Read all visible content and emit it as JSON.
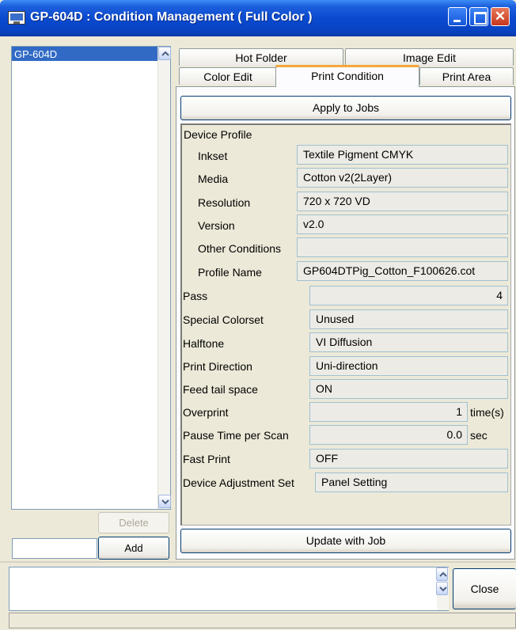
{
  "window": {
    "title": "GP-604D : Condition Management ( Full Color )",
    "title_color": "#0a4ad0"
  },
  "left_panel": {
    "items": [
      {
        "label": "GP-604D",
        "selected": true
      }
    ],
    "delete_label": "Delete",
    "name_input_value": "",
    "add_label": "Add"
  },
  "tabs": [
    {
      "label": "Hot Folder",
      "active": false
    },
    {
      "label": "Image Edit",
      "active": false
    },
    {
      "label": "Color Edit",
      "active": false
    },
    {
      "label": "Print Condition",
      "active": true
    },
    {
      "label": "Print Area",
      "active": false
    }
  ],
  "buttons": {
    "apply": "Apply to Jobs",
    "update": "Update with Job",
    "close": "Close"
  },
  "device_profile": {
    "heading": "Device Profile",
    "inkset": {
      "label": "Inkset",
      "value": "Textile Pigment CMYK"
    },
    "media": {
      "label": "Media",
      "value": "Cotton v2(2Layer)"
    },
    "resolution": {
      "label": "Resolution",
      "value": "720 x 720 VD"
    },
    "version": {
      "label": "Version",
      "value": "v2.0"
    },
    "other_conditions": {
      "label": "Other Conditions",
      "value": ""
    },
    "profile_name": {
      "label": "Profile Name",
      "value": "GP604DTPig_Cotton_F100626.cot"
    }
  },
  "settings": {
    "pass": {
      "label": "Pass",
      "value": "4"
    },
    "special_colorset": {
      "label": "Special Colorset",
      "value": "Unused"
    },
    "halftone": {
      "label": "Halftone",
      "value": "VI Diffusion"
    },
    "print_direction": {
      "label": "Print Direction",
      "value": "Uni-direction"
    },
    "feed_tail_space": {
      "label": "Feed tail space",
      "value": "ON"
    },
    "overprint": {
      "label": "Overprint",
      "value": "1",
      "unit": "time(s)"
    },
    "pause_time": {
      "label": "Pause Time per Scan",
      "value": "0.0",
      "unit": "sec"
    },
    "fast_print": {
      "label": "Fast Print",
      "value": "OFF"
    },
    "device_adjustment_set": {
      "label": "Device Adjustment Set",
      "value": "Panel Setting"
    }
  },
  "message_box": {
    "text": ""
  },
  "status_bar": {
    "text": ""
  }
}
